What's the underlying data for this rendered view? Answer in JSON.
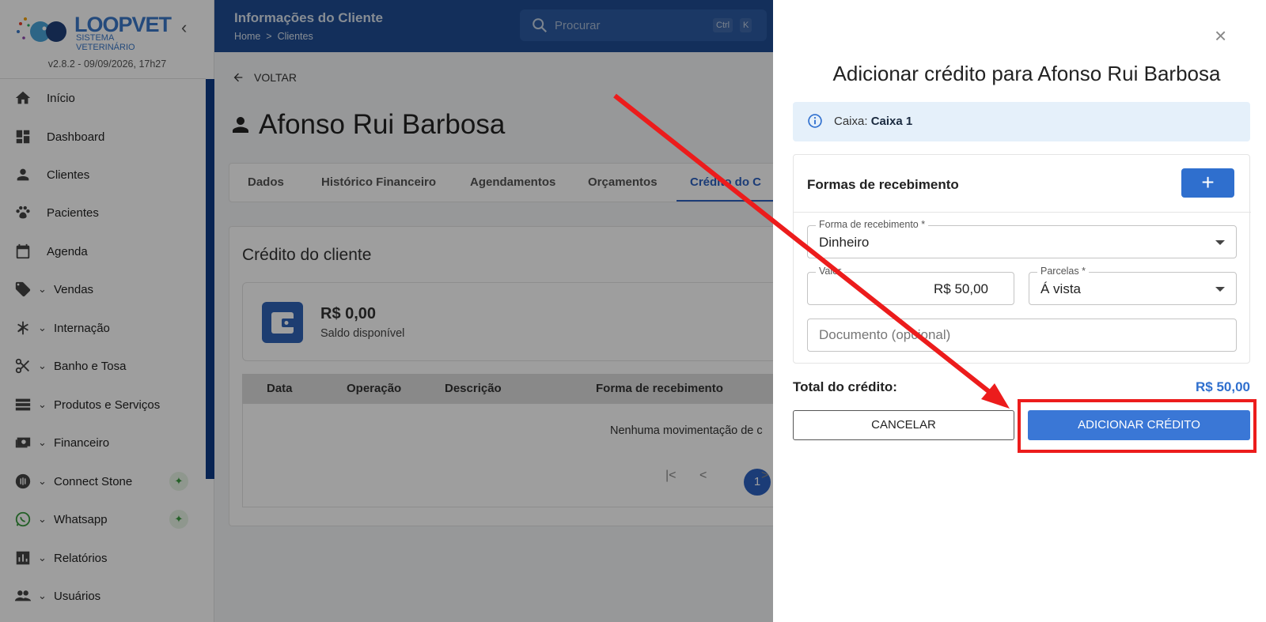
{
  "app": {
    "logo_main": "LOOPVET",
    "logo_sub": "SISTEMA VETERINÁRIO",
    "version": "v2.8.2 - 09/09/2026, 17h27"
  },
  "sidebar": {
    "items": [
      {
        "label": "Início",
        "icon": "home-icon"
      },
      {
        "label": "Dashboard",
        "icon": "dashboard-icon"
      },
      {
        "label": "Clientes",
        "icon": "person-icon"
      },
      {
        "label": "Pacientes",
        "icon": "paw-icon"
      },
      {
        "label": "Agenda",
        "icon": "calendar-icon"
      },
      {
        "label": "Vendas",
        "icon": "tag-icon"
      },
      {
        "label": "Internação",
        "icon": "asterisk-icon"
      },
      {
        "label": "Banho e Tosa",
        "icon": "scissors-icon"
      },
      {
        "label": "Produtos e Serviços",
        "icon": "list-icon"
      },
      {
        "label": "Financeiro",
        "icon": "money-icon"
      },
      {
        "label": "Connect Stone",
        "icon": "nfc-icon"
      },
      {
        "label": "Whatsapp",
        "icon": "whatsapp-icon"
      },
      {
        "label": "Relatórios",
        "icon": "bar-chart-icon"
      },
      {
        "label": "Usuários",
        "icon": "group-icon"
      }
    ]
  },
  "header": {
    "title": "Informações do Cliente",
    "breadcrumb_home": "Home",
    "breadcrumb_sep": ">",
    "breadcrumb_current": "Clientes",
    "search_placeholder": "Procurar",
    "kbd_ctrl": "Ctrl",
    "kbd_k": "K"
  },
  "main": {
    "back_label": "VOLTAR",
    "client_name": "Afonso Rui Barbosa",
    "tabs": [
      "Dados",
      "Histórico Financeiro",
      "Agendamentos",
      "Orçamentos",
      "Crédito do C"
    ],
    "card_title": "Crédito do cliente",
    "saldo_value": "R$ 0,00",
    "saldo_label": "Saldo disponível",
    "columns": [
      "Data",
      "Operação",
      "Descrição",
      "Forma de recebimento"
    ],
    "empty_text": "Nenhuma movimentação de c",
    "pagination": {
      "first": "|<",
      "prev": "<",
      "current": "1",
      "next": ">"
    }
  },
  "drawer": {
    "title": "Adicionar crédito para Afonso Rui Barbosa",
    "caixa_label": "Caixa:",
    "caixa_value": "Caixa 1",
    "formas_title": "Formas de recebimento",
    "add_symbol": "+",
    "forma_label": "Forma de recebimento *",
    "forma_value": "Dinheiro",
    "valor_label": "Valor",
    "valor_value": "R$ 50,00",
    "parcelas_label": "Parcelas *",
    "parcelas_value": "Á vista",
    "documento_placeholder": "Documento (opcional)",
    "total_label": "Total do crédito:",
    "total_value": "R$ 50,00",
    "cancel_label": "CANCELAR",
    "submit_label": "ADICIONAR CRÉDITO",
    "close_symbol": "×"
  },
  "colors": {
    "primary": "#2f6fce",
    "header": "#1f4d93",
    "annotation": "#ec1c1c"
  }
}
